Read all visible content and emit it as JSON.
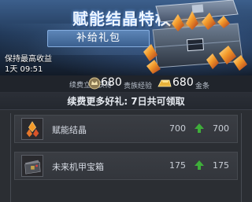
{
  "banner": {
    "title": "赋能结晶特权",
    "subtitle": "补给礼包",
    "note": "保持最高收益",
    "timer": "1天 09:51"
  },
  "renew_rewards": {
    "label": "续费立即获得",
    "noble_exp_value": "680",
    "noble_exp_unit": "贵族经验",
    "gold_value": "680",
    "gold_unit": "金条",
    "icons": [
      "noble-badge-icon",
      "gold-bar-icon"
    ]
  },
  "gift": {
    "header": "续费更多好礼: 7日共可领取",
    "items": [
      {
        "name": "赋能结晶",
        "base": "700",
        "total": "700",
        "icon": "energy-crystal-icon"
      },
      {
        "name": "未来机甲宝箱",
        "base": "175",
        "total": "175",
        "icon": "mech-chest-icon"
      }
    ]
  },
  "colors": {
    "accent_green": "#3fae3a",
    "gold": "#e8b23a",
    "banner_blue": "#3c5f8c"
  }
}
